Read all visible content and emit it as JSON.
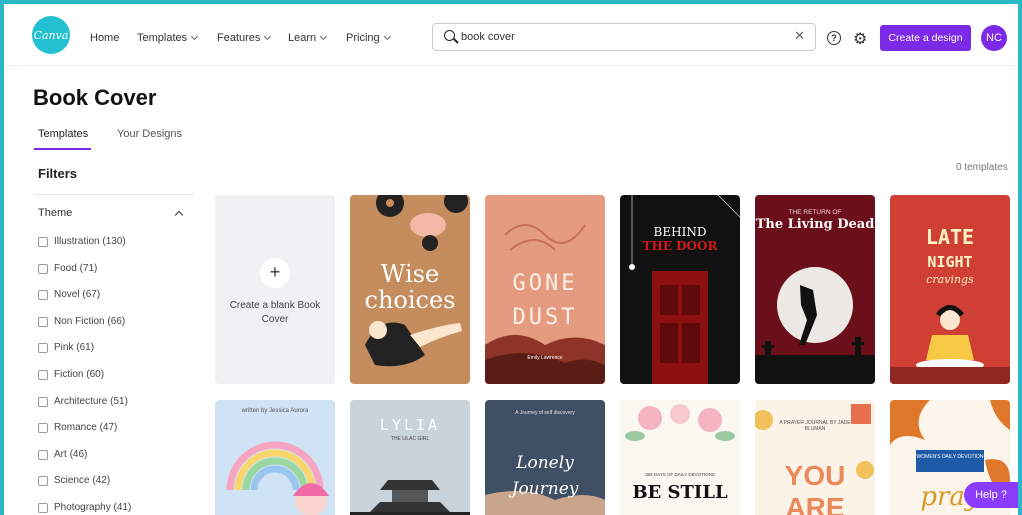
{
  "nav": {
    "logo": "Canva",
    "home": "Home",
    "templates": "Templates",
    "features": "Features",
    "learn": "Learn",
    "pricing": "Pricing",
    "search_value": "book cover",
    "create_button": "Create a design",
    "avatar_initials": "NC",
    "help_icon_glyph": "?",
    "gear_icon_glyph": "⚙",
    "clear_icon_glyph": "✕"
  },
  "page": {
    "title": "Book Cover",
    "tabs": [
      {
        "label": "Templates"
      },
      {
        "label": "Your Designs"
      }
    ],
    "active_tab": "Templates",
    "template_count": "0 templates"
  },
  "filters": {
    "heading": "Filters",
    "theme_heading": "Theme",
    "items": [
      {
        "label": "Illustration",
        "count": "(130)"
      },
      {
        "label": "Food",
        "count": "(71)"
      },
      {
        "label": "Novel",
        "count": "(67)"
      },
      {
        "label": "Non Fiction",
        "count": "(66)"
      },
      {
        "label": "Pink",
        "count": "(61)"
      },
      {
        "label": "Fiction",
        "count": "(60)"
      },
      {
        "label": "Architecture",
        "count": "(51)"
      },
      {
        "label": "Romance",
        "count": "(47)"
      },
      {
        "label": "Art",
        "count": "(46)"
      },
      {
        "label": "Science",
        "count": "(42)"
      },
      {
        "label": "Photography",
        "count": "(41)"
      }
    ]
  },
  "blank_card": {
    "plus": "+",
    "label": "Create a blank Book Cover"
  },
  "covers": {
    "wise": {
      "title1": "Wise",
      "title2": "choices"
    },
    "dust": {
      "title1": "GONE",
      "title2": "DUST",
      "author": "Emily Lawrence"
    },
    "door": {
      "title1": "BEHIND",
      "title2": "THE DOOR"
    },
    "dead": {
      "subtitle": "THE RETURN OF",
      "title": "The Living Dead"
    },
    "late": {
      "title1": "LATE",
      "title2": "NIGHT",
      "title3": "cravings"
    },
    "rainbow": {
      "byline": "written by Jessica Aurora"
    },
    "lylia": {
      "title": "LYLIA",
      "subtitle": "THE LILAC GIRL"
    },
    "lonely": {
      "title1": "Lonely",
      "title2": "Journey",
      "subtitle": "A Journey of self discovery"
    },
    "still": {
      "subtitle": "365 DAYS OF DAILY DEVOTIONS",
      "title": "BE STILL"
    },
    "you": {
      "subtitle": "A PRAYER JOURNAL BY JADE BLUMAN",
      "title": "YOU ARE"
    },
    "pray": {
      "subtitle": "WOMEN'S DAILY DEVOTION",
      "title": "pray"
    }
  },
  "help_widget": "Help ?",
  "colors": {
    "brand_purple": "#7d2ae8",
    "accent_teal": "#22c0d0"
  }
}
